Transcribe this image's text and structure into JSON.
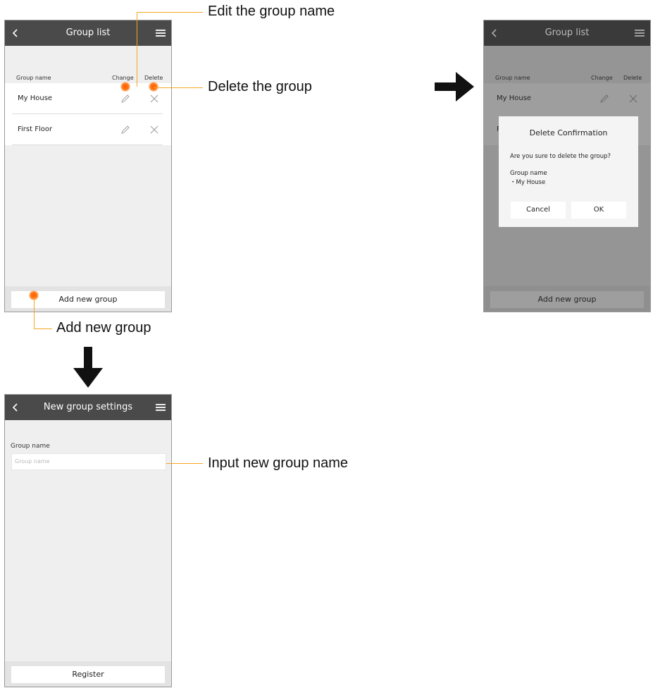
{
  "screen1": {
    "header": {
      "title": "Group list"
    },
    "columns": {
      "group_name": "Group name",
      "change": "Change",
      "delete": "Delete"
    },
    "rows": [
      {
        "name": "My House"
      },
      {
        "name": "First Floor"
      }
    ],
    "footer_button": "Add new group"
  },
  "screen2": {
    "header": {
      "title": "Group list"
    },
    "columns": {
      "group_name": "Group name",
      "change": "Change",
      "delete": "Delete"
    },
    "rows": [
      {
        "name": "My House"
      },
      {
        "name": "F"
      }
    ],
    "footer_button": "Add new group",
    "dialog": {
      "title": "Delete Confirmation",
      "question": "Are you sure to delete the group?",
      "group_label": "Group name",
      "group_value": "・My House",
      "cancel": "Cancel",
      "ok": "OK"
    }
  },
  "screen3": {
    "header": {
      "title": "New group settings"
    },
    "field_label": "Group name",
    "field_placeholder": "Group name",
    "field_value": "",
    "footer_button": "Register"
  },
  "annotations": {
    "edit": "Edit the group name",
    "delete": "Delete the group",
    "add": "Add new group",
    "input": "Input new group name"
  },
  "colors": {
    "header": "#4a4a4a",
    "background": "#efefef",
    "highlight": "#ff6a00",
    "callout_line": "#f5a623"
  },
  "icons": [
    "back-chevron-icon",
    "hamburger-menu-icon",
    "pencil-icon",
    "close-x-icon",
    "right-arrow-icon",
    "down-arrow-icon"
  ]
}
